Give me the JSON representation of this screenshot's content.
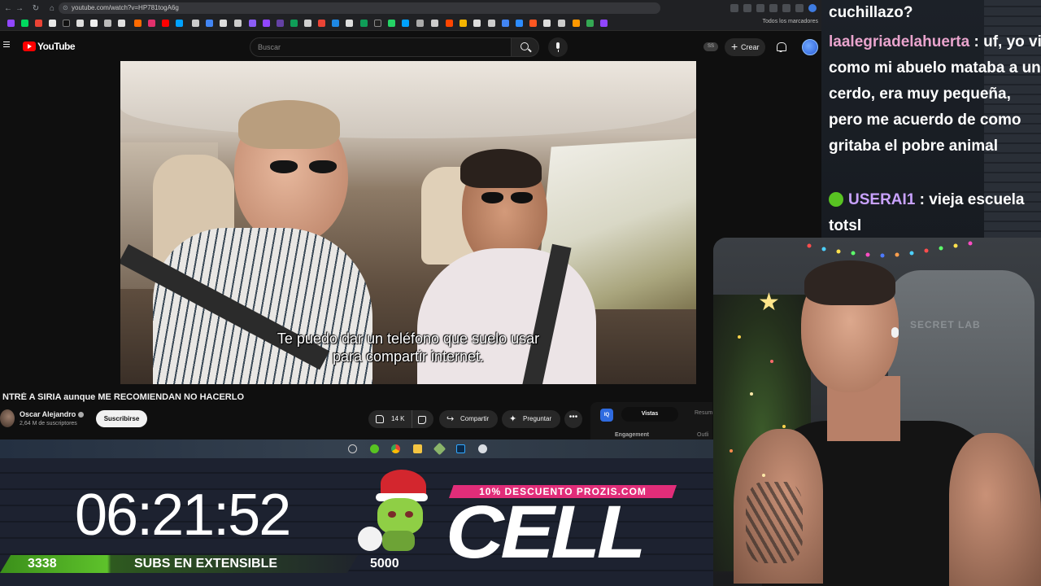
{
  "browser": {
    "url": "youtube.com/watch?v=HP781togA6g",
    "bookmarks_all": "Todos los marcadores"
  },
  "youtube": {
    "logo_text": "YouTube",
    "search_placeholder": "Buscar",
    "ss_badge": "SS",
    "create_label": "Crear",
    "video": {
      "subtitle_line1": "Te puedo dar un teléfono que suelo usar",
      "subtitle_line2": "para compartir internet.",
      "title": "NTRÉ A SIRIA aunque ME RECOMIENDAN NO HACERLO",
      "channel_name": "Oscar Alejandro",
      "channel_subs": "2,64 M de suscriptores",
      "subscribe_label": "Suscribirse",
      "likes": "14 K",
      "share_label": "Compartir",
      "ask_label": "Preguntar",
      "more_label": "•••"
    },
    "panel": {
      "iq": "IQ",
      "tab_active": "Vistas",
      "tab_next": "Resum",
      "engagement": "Engagement",
      "outlier": "Outli"
    }
  },
  "overlay": {
    "timer": "06:21:52",
    "subs_current": "3338",
    "subs_text": "SUBS EN EXTENSIBLE",
    "subs_goal": "5000",
    "promo": "10% DESCUENTO PROZIS.COM",
    "brand": "CELL"
  },
  "chat": {
    "messages": [
      {
        "user": "",
        "text": "cuchillazo?"
      },
      {
        "user": "laalegriadelahuerta",
        "text": " : uf, yo vi como mi abuelo mataba a un cerdo, era muy pequeña, pero me acuerdo de como gritaba el pobre animal"
      },
      {
        "user": "USERAI1",
        "text": " : vieja escuela totsl"
      }
    ]
  },
  "webcam": {
    "chair_brand": "SECRET LAB"
  },
  "colors": {
    "yt_red": "#ff0000",
    "promo_pink": "#e12d79",
    "subs_green": "#5ec22b",
    "chat_user_pink": "#e9a4cd",
    "chat_user_purple": "#c9a2ff"
  }
}
